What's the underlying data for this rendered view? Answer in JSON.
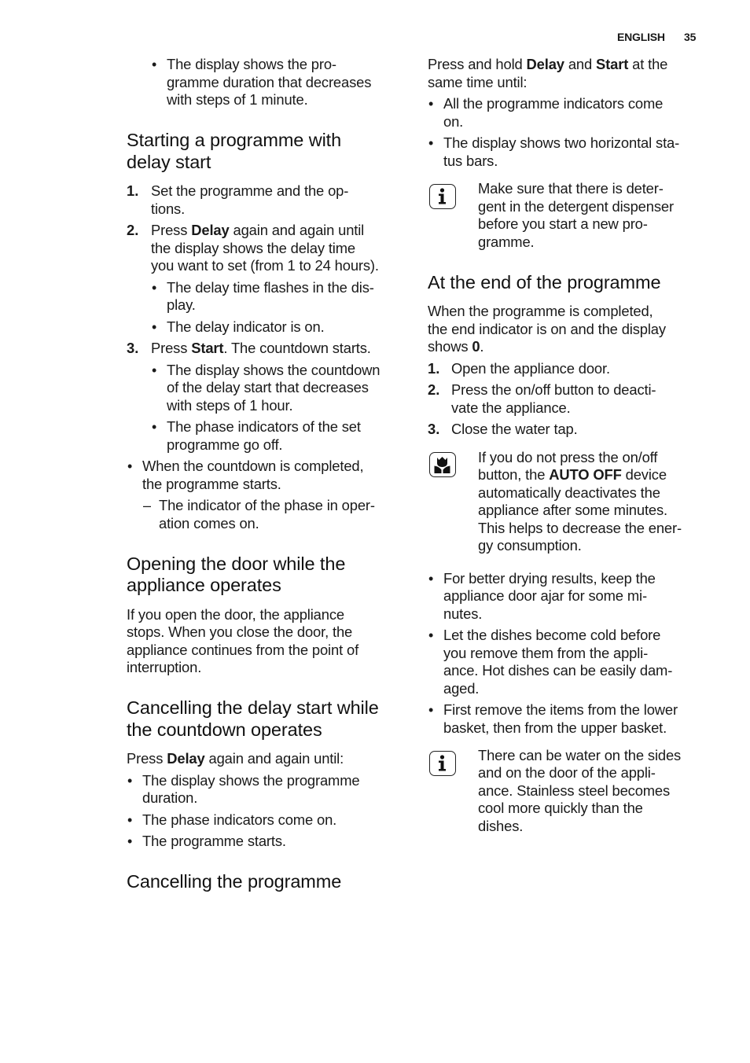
{
  "header": {
    "language": "ENGLISH",
    "page_number": "35"
  },
  "left": {
    "intro_bullet": [
      "The display shows the pro-",
      "gramme duration that decreases",
      "with steps of 1 minute."
    ],
    "section1": {
      "title": [
        "Starting a programme with",
        "delay start"
      ],
      "step1": {
        "num": "1.",
        "lines": [
          "Set the programme and the op-",
          "tions."
        ]
      },
      "step2": {
        "num": "2.",
        "pre": "Press ",
        "bold": "Delay",
        "post": " again and again until",
        "lines": [
          "the display shows the delay time",
          "you want to set (from 1 to 24 hours)."
        ]
      },
      "step2_bullets": [
        [
          "The delay time flashes in the dis-",
          "play."
        ],
        [
          "The delay indicator is on."
        ]
      ],
      "step3": {
        "num": "3.",
        "pre": "Press ",
        "bold": "Start",
        "post": ". The countdown starts."
      },
      "step3_bullets": [
        [
          "The display shows the countdown",
          "of the delay start that decreases",
          "with steps of 1 hour."
        ],
        [
          "The phase indicators of the set",
          "programme go off."
        ]
      ],
      "bullet": [
        "When the countdown is completed,",
        "the programme starts."
      ],
      "dash": [
        "The indicator of the phase in oper-",
        "ation comes on."
      ]
    },
    "section2": {
      "title": [
        "Opening the door while the",
        "appliance operates"
      ],
      "body": [
        "If you open the door, the appliance",
        "stops. When you close the door, the",
        "appliance continues from the point of",
        "interruption."
      ]
    },
    "section3": {
      "title": [
        "Cancelling the delay start while",
        "the countdown operates"
      ],
      "intro": {
        "pre": "Press ",
        "bold": "Delay",
        "post": " again and again until:"
      },
      "bullets": [
        [
          "The display shows the programme",
          "duration."
        ],
        [
          "The phase indicators come on."
        ],
        [
          "The programme starts."
        ]
      ]
    },
    "section4": {
      "title": "Cancelling the programme"
    }
  },
  "right": {
    "cancel_intro": {
      "pre": "Press and hold ",
      "bold1": "Delay",
      "mid": " and ",
      "bold2": "Start",
      "post": " at the",
      "line2": "same time until:"
    },
    "cancel_bullets": [
      [
        "All the programme indicators come",
        "on."
      ],
      [
        "The display shows two horizontal sta-",
        "tus bars."
      ]
    ],
    "info_note1": {
      "icon": "info-icon",
      "lines": [
        "Make sure that there is deter-",
        "gent in the detergent dispenser",
        "before you start a new pro-",
        "gramme."
      ]
    },
    "section5": {
      "title": "At the end of the programme",
      "body": [
        "When the programme is completed,",
        "the end indicator is on and the display"
      ],
      "body_last": {
        "pre": "shows ",
        "bold": "0",
        "post": "."
      },
      "steps": [
        {
          "num": "1.",
          "lines": [
            "Open the appliance door."
          ]
        },
        {
          "num": "2.",
          "lines": [
            "Press the on/off button to deacti-",
            "vate the appliance."
          ]
        },
        {
          "num": "3.",
          "lines": [
            "Close the water tap."
          ]
        }
      ]
    },
    "env_note": {
      "icon": "environment-tulip-icon",
      "line1": "If you do not press the on/off",
      "line2": {
        "pre": "button, the ",
        "bold": "AUTO OFF",
        "post": " device"
      },
      "lines": [
        "automatically deactivates the",
        "appliance after some minutes.",
        "This helps to decrease the ener-",
        "gy consumption."
      ]
    },
    "tips": [
      [
        "For better drying results, keep the",
        "appliance door ajar for some mi-",
        "nutes."
      ],
      [
        "Let the dishes become cold before",
        "you remove them from the appli-",
        "ance. Hot dishes can be easily dam-",
        "aged."
      ],
      [
        "First remove the items from the lower",
        "basket, then from the upper basket."
      ]
    ],
    "info_note2": {
      "icon": "info-icon",
      "lines": [
        "There can be water on the sides",
        "and on the door of the appli-",
        "ance. Stainless steel becomes",
        "cool more quickly than the",
        "dishes."
      ]
    }
  }
}
